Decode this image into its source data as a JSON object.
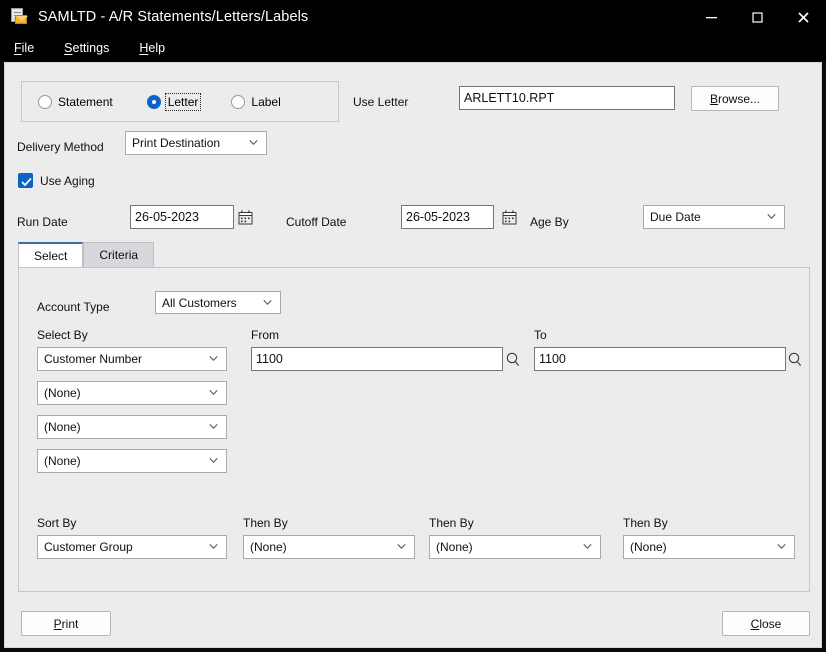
{
  "window": {
    "title": "SAMLTD - A/R Statements/Letters/Labels",
    "icon": "document-envelope-icon",
    "controls": {
      "minimize": "minimize-icon",
      "maximize": "maximize-icon",
      "close": "close-icon"
    }
  },
  "menu": {
    "items": [
      {
        "label": "File",
        "accel": "F"
      },
      {
        "label": "Settings",
        "accel": "S"
      },
      {
        "label": "Help",
        "accel": "H"
      }
    ]
  },
  "form": {
    "type_group": {
      "options": [
        {
          "label": "Statement",
          "selected": false,
          "focused": false
        },
        {
          "label": "Letter",
          "selected": true,
          "focused": true
        },
        {
          "label": "Label",
          "selected": false,
          "focused": false
        }
      ]
    },
    "use_letter": {
      "label": "Use Letter",
      "value": "ARLETT10.RPT",
      "browse_label": "Browse...",
      "browse_accel": "B"
    },
    "delivery_method": {
      "label": "Delivery Method",
      "value": "Print Destination"
    },
    "use_aging": {
      "label": "Use Aging",
      "checked": true,
      "accent": "#0a64c8"
    },
    "run_date": {
      "label": "Run Date",
      "value": "26-05-2023",
      "calendar_icon": "calendar-icon"
    },
    "cutoff_date": {
      "label": "Cutoff Date",
      "value": "26-05-2023",
      "calendar_icon": "calendar-icon"
    },
    "age_by": {
      "label": "Age By",
      "value": "Due Date"
    }
  },
  "tabs": {
    "items": [
      {
        "label": "Select",
        "active": true
      },
      {
        "label": "Criteria",
        "active": false
      }
    ],
    "active_accent": "#3a6ea5"
  },
  "select_tab": {
    "account_type": {
      "label": "Account Type",
      "value": "All Customers"
    },
    "select_by": {
      "label": "Select By",
      "values": [
        "Customer Number",
        "(None)",
        "(None)",
        "(None)"
      ]
    },
    "from": {
      "label": "From",
      "value": "1100",
      "finder_icon": "magnifier-icon"
    },
    "to": {
      "label": "To",
      "value": "1100",
      "finder_icon": "magnifier-icon"
    },
    "sort_by": {
      "label": "Sort By",
      "value": "Customer Group"
    },
    "then_by": [
      {
        "label": "Then By",
        "value": "(None)"
      },
      {
        "label": "Then By",
        "value": "(None)"
      },
      {
        "label": "Then By",
        "value": "(None)"
      }
    ]
  },
  "footer": {
    "print": {
      "label": "Print",
      "accel": "P"
    },
    "close": {
      "label": "Close",
      "accel": "C"
    }
  }
}
